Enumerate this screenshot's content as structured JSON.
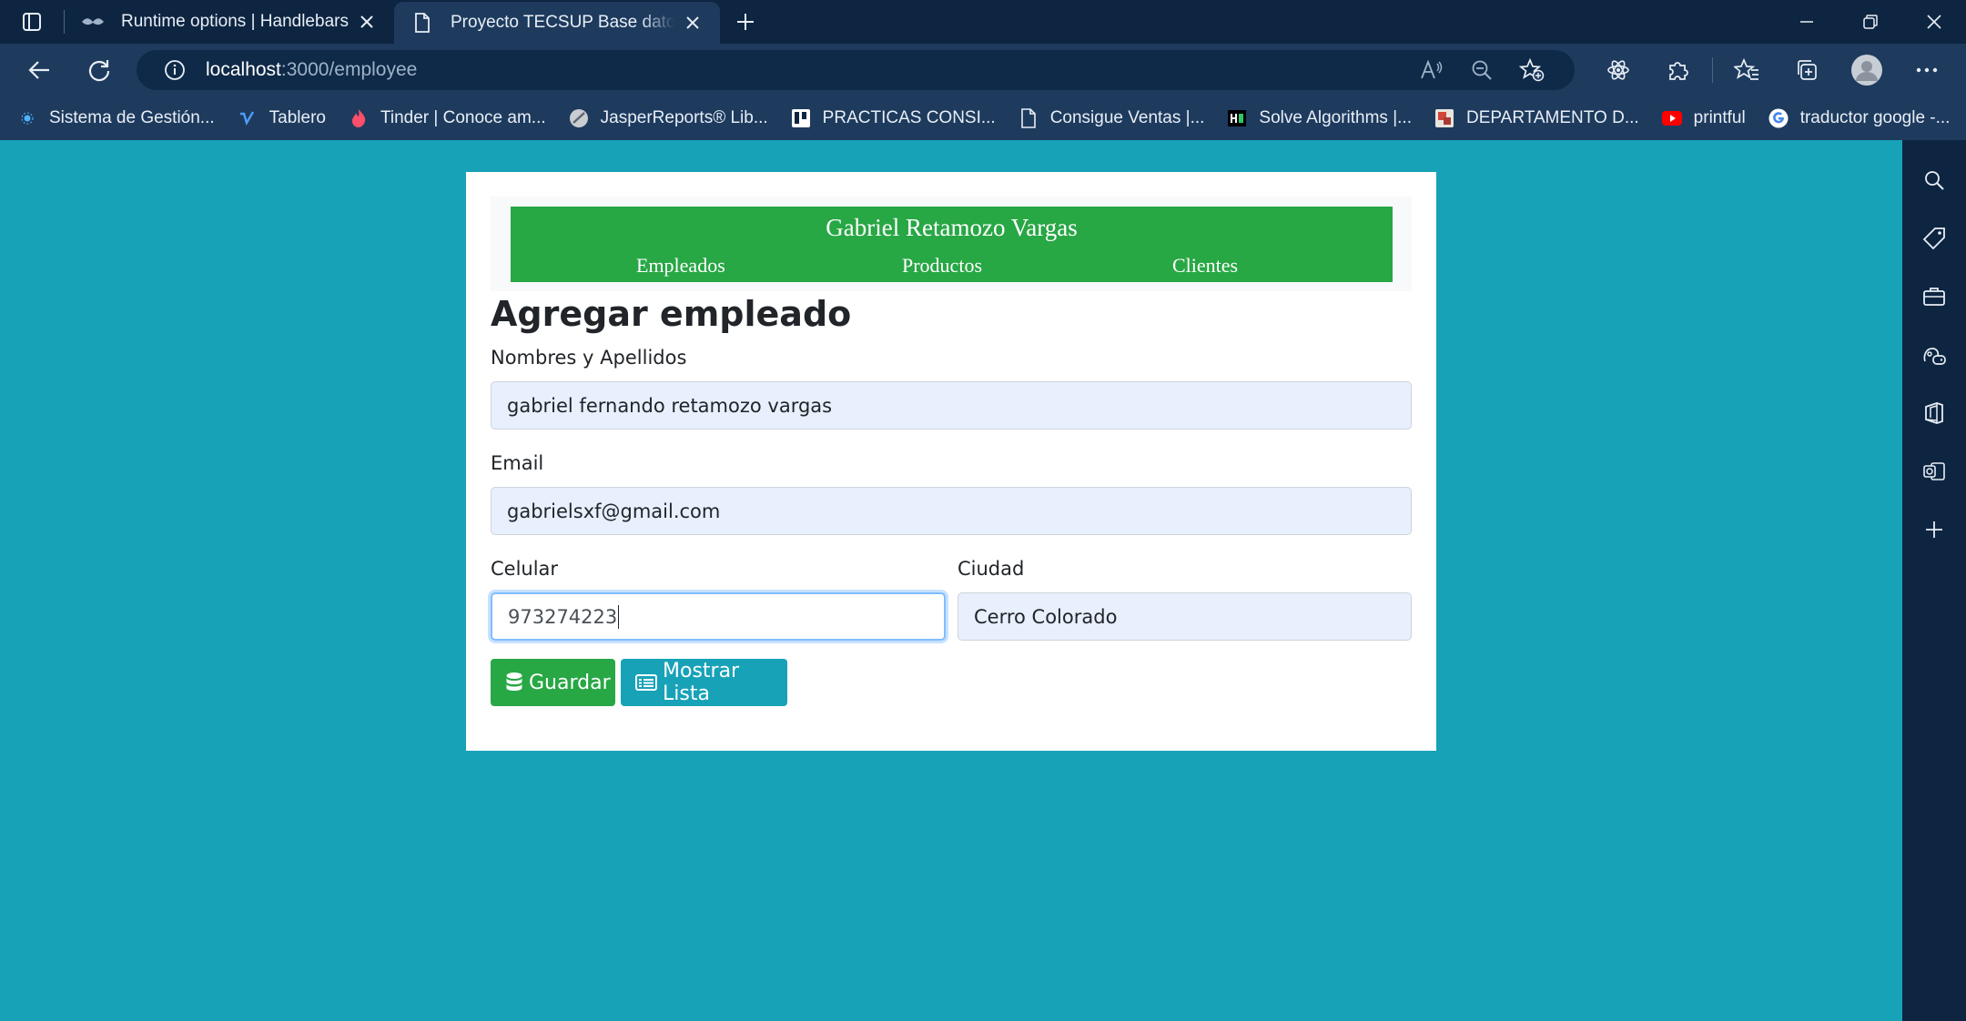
{
  "browser": {
    "tabs": [
      {
        "title": "Runtime options | Handlebars",
        "active": false
      },
      {
        "title": "Proyecto TECSUP Base datos avanzado",
        "active": true
      }
    ],
    "address": {
      "host": "localhost",
      "path": ":3000/employee"
    },
    "bookmarks": [
      {
        "label": "Sistema de Gestión...",
        "icon": "dot-icon"
      },
      {
        "label": "Tablero",
        "icon": "vimeo-icon"
      },
      {
        "label": "Tinder | Conoce am...",
        "icon": "flame-icon"
      },
      {
        "label": "JasperReports® Lib...",
        "icon": "jasper-icon"
      },
      {
        "label": "PRACTICAS CONSI...",
        "icon": "trello-icon"
      },
      {
        "label": "Consigue Ventas |...",
        "icon": "page-icon"
      },
      {
        "label": "Solve Algorithms |...",
        "icon": "hackerrank-icon"
      },
      {
        "label": "DEPARTAMENTO D...",
        "icon": "dept-icon"
      },
      {
        "label": "printful",
        "icon": "youtube-icon"
      },
      {
        "label": "traductor google -...",
        "icon": "google-icon"
      }
    ]
  },
  "page": {
    "brand": "Gabriel Retamozo Vargas",
    "nav": [
      "Empleados",
      "Productos",
      "Clientes"
    ],
    "form_title": "Agregar empleado",
    "fields": {
      "name": {
        "label": "Nombres y Apellidos",
        "value": "gabriel fernando retamozo vargas"
      },
      "email": {
        "label": "Email",
        "value": "gabrielsxf@gmail.com"
      },
      "phone": {
        "label": "Celular",
        "value": "973274223"
      },
      "city": {
        "label": "Ciudad",
        "value": "Cerro Colorado"
      }
    },
    "buttons": {
      "save": "Guardar",
      "list": "Mostrar Lista"
    }
  },
  "colors": {
    "page_bg": "#17a2b8",
    "header_green": "#28a745",
    "button_info": "#17a2b8",
    "browser_dark": "#0d2541",
    "browser_toolbar": "#1e3b5e"
  }
}
